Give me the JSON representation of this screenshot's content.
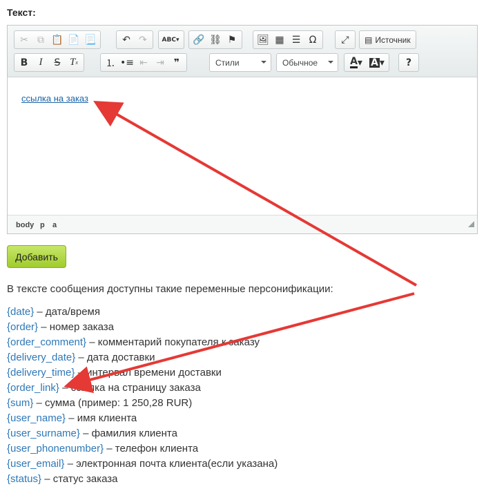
{
  "field_label": "Текст:",
  "toolbar": {
    "styles_label": "Стили",
    "format_label": "Обычное",
    "source_label": "Источник",
    "spell_label": "ABC",
    "help_label": "?"
  },
  "editor": {
    "link_text": "ссылка на заказ",
    "status_path": [
      "body",
      "p",
      "a"
    ]
  },
  "add_button_label": "Добавить",
  "intro_text": "В тексте сообщения доступны такие переменные персонификации:",
  "variables": [
    {
      "token": "{date}",
      "desc": "– дата/время"
    },
    {
      "token": "{order}",
      "desc": "– номер заказа"
    },
    {
      "token": "{order_comment}",
      "desc": "– комментарий покупателя к заказу"
    },
    {
      "token": "{delivery_date}",
      "desc": "– дата доставки"
    },
    {
      "token": "{delivery_time}",
      "desc": "– интервал времени доставки"
    },
    {
      "token": "{order_link}",
      "desc": "– ссылка на страницу заказа"
    },
    {
      "token": "{sum}",
      "desc": "– сумма (пример: 1 250,28 RUR)"
    },
    {
      "token": "{user_name}",
      "desc": "– имя клиента"
    },
    {
      "token": "{user_surname}",
      "desc": "– фамилия клиента"
    },
    {
      "token": "{user_phonenumber}",
      "desc": "– телефон клиента"
    },
    {
      "token": "{user_email}",
      "desc": "– электронная почта клиента(если указана)"
    },
    {
      "token": "{status}",
      "desc": "– статус заказа"
    }
  ],
  "colors": {
    "link": "#1a63a8",
    "token": "#2d78b8",
    "arrow": "#e53935",
    "add_button": "#a8d13a"
  }
}
